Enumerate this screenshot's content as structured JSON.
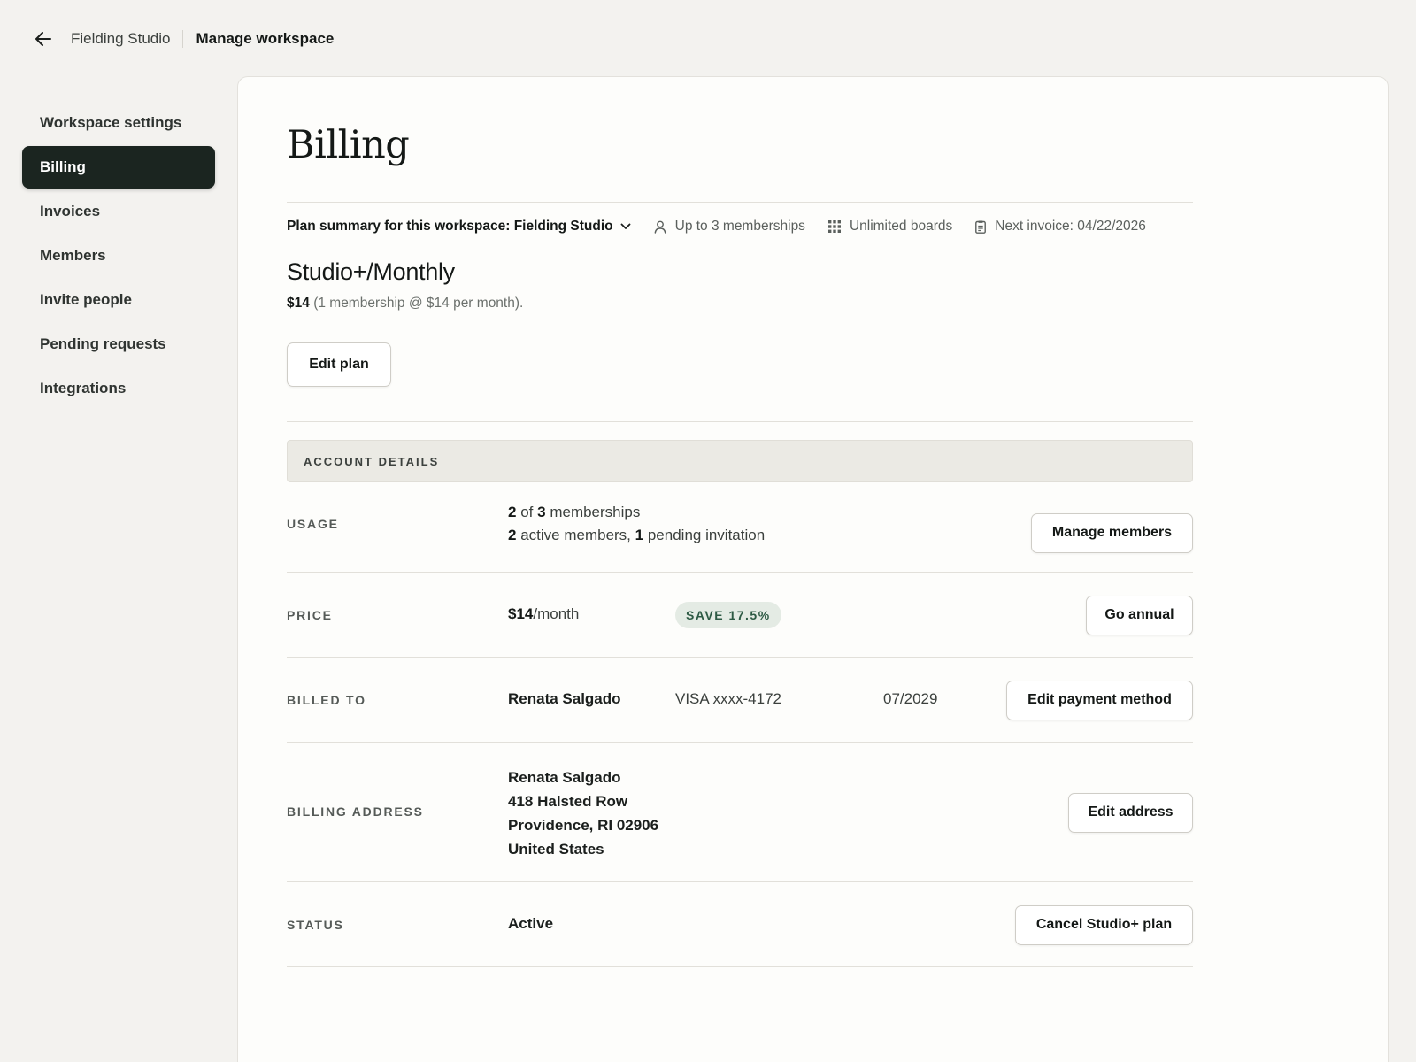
{
  "header": {
    "back_label": "Back",
    "parent": "Fielding Studio",
    "current": "Manage workspace"
  },
  "sidebar": {
    "items": [
      {
        "label": "Workspace settings",
        "active": false
      },
      {
        "label": "Billing",
        "active": true
      },
      {
        "label": "Invoices",
        "active": false
      },
      {
        "label": "Members",
        "active": false
      },
      {
        "label": "Invite people",
        "active": false
      },
      {
        "label": "Pending requests",
        "active": false
      },
      {
        "label": "Integrations",
        "active": false
      }
    ]
  },
  "page": {
    "title": "Billing"
  },
  "plan_summary": {
    "selector_label": "Plan summary for this workspace: Fielding Studio",
    "memberships": "Up to 3 memberships",
    "boards": "Unlimited boards",
    "next_invoice": "Next invoice: 04/22/2026",
    "plan_name": "Studio+/Monthly",
    "price_amount": "$14",
    "price_detail": "(1 membership @ $14 per month).",
    "edit_plan_label": "Edit plan"
  },
  "account_details": {
    "header": "ACCOUNT DETAILS",
    "usage": {
      "label": "USAGE",
      "used": "2",
      "of": "of",
      "total": "3",
      "unit": "memberships",
      "active_count": "2",
      "active_text": "active members,",
      "pending_count": "1",
      "pending_text": "pending invitation",
      "button": "Manage members"
    },
    "price": {
      "label": "PRICE",
      "amount": "$14",
      "period": "/month",
      "badge": "SAVE 17.5%",
      "button": "Go annual"
    },
    "billed_to": {
      "label": "BILLED TO",
      "name": "Renata Salgado",
      "card": "VISA xxxx-4172",
      "expiry": "07/2029",
      "button": "Edit payment method"
    },
    "billing_address": {
      "label": "BILLING ADDRESS",
      "lines": [
        "Renata Salgado",
        "418 Halsted Row",
        "Providence, RI 02906",
        "United States"
      ],
      "button": "Edit address"
    },
    "status": {
      "label": "STATUS",
      "value": "Active",
      "button": "Cancel Studio+ plan"
    }
  },
  "colors": {
    "background": "#f3f2ef",
    "panel": "#fdfdfb",
    "sidebar_active": "#1b2520",
    "badge_bg": "#e4ebe4",
    "badge_text": "#2d5a44"
  },
  "icons": [
    "arrow-left-icon",
    "chevron-down-icon",
    "user-icon",
    "grid-icon",
    "document-icon"
  ]
}
